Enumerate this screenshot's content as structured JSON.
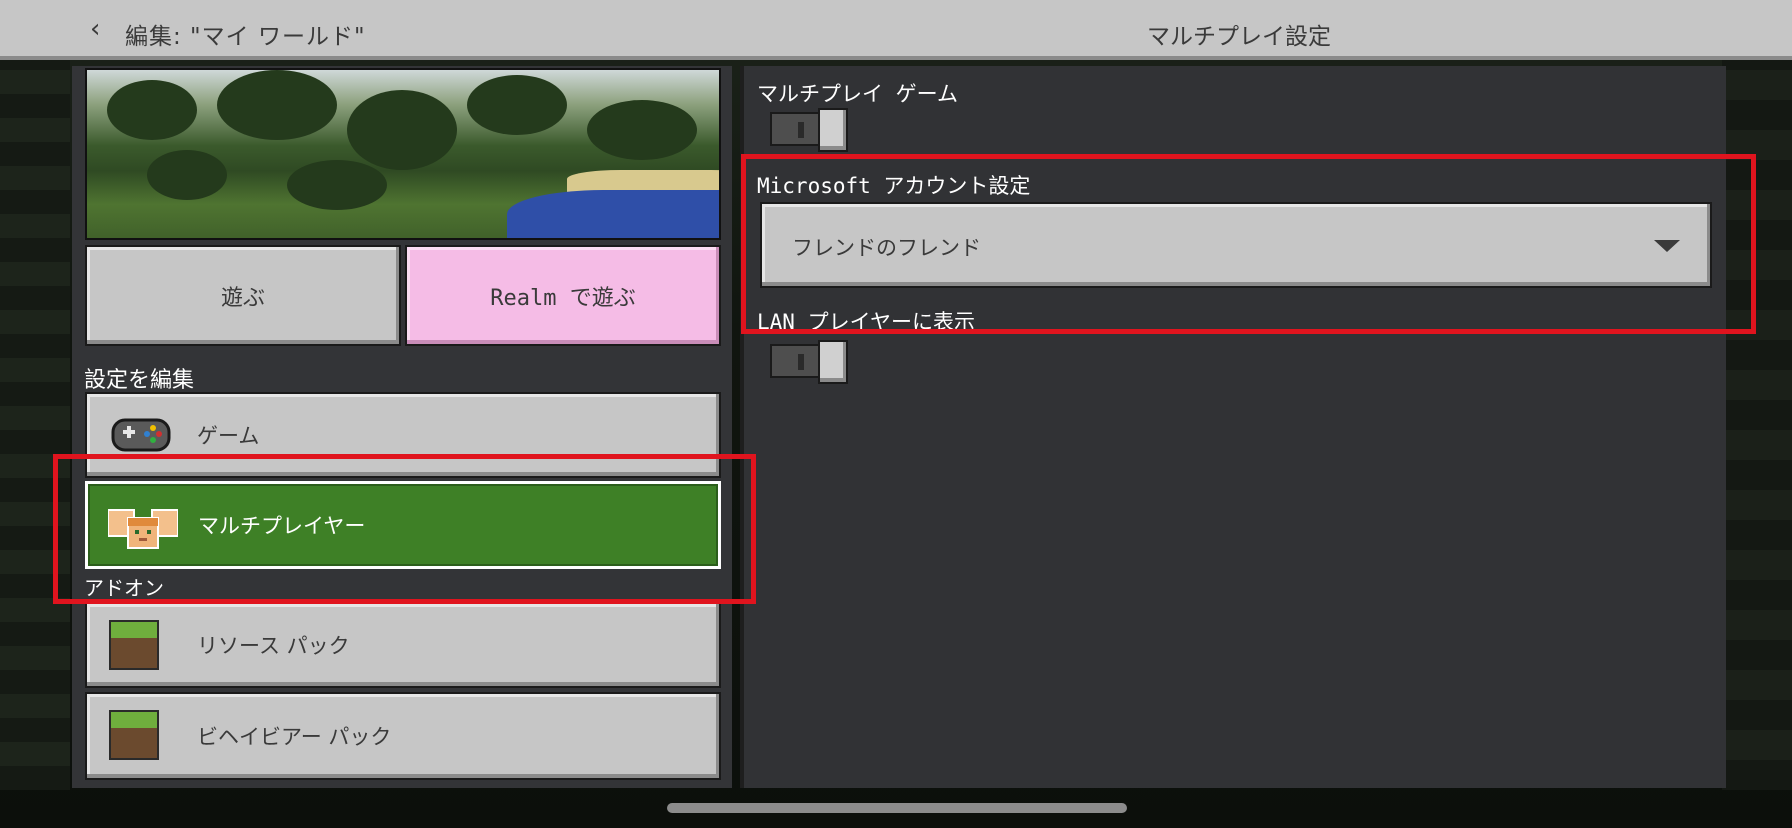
{
  "header": {
    "back_label": "編集: \"マイ ワールド\"",
    "title": "マルチプレイ設定"
  },
  "left": {
    "play_button": "遊ぶ",
    "realm_button": "Realm で遊ぶ",
    "edit_settings_heading": "設定を編集",
    "items": [
      {
        "label": "ゲーム",
        "icon": "controller-icon"
      },
      {
        "label": "マルチプレイヤー",
        "icon": "players-icon",
        "selected": true
      }
    ],
    "addons_heading": "アドオン",
    "addons": [
      {
        "label": "リソース パック",
        "icon": "grass-block-icon"
      },
      {
        "label": "ビヘイビアー パック",
        "icon": "grass-block-icon"
      }
    ]
  },
  "right": {
    "multiplayer_game_label": "マルチプレイ ゲーム",
    "multiplayer_game_on": false,
    "ms_account_label": "Microsoft アカウント設定",
    "ms_account_value": "フレンドのフレンド",
    "lan_label": "LAN プレイヤーに表示",
    "lan_on": false
  },
  "colors": {
    "highlight": "#e0141e",
    "selected_item": "#3e8026",
    "realm_button": "#f5bce6",
    "panel": "#333437",
    "button": "#c6c6c6"
  }
}
